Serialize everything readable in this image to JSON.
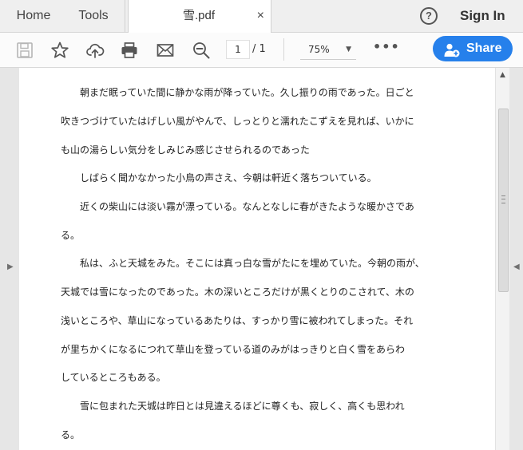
{
  "tabs": {
    "home": "Home",
    "tools": "Tools",
    "document": "雪.pdf",
    "close": "×"
  },
  "header": {
    "help": "?",
    "sign_in": "Sign In"
  },
  "toolbar": {
    "page_current": "1",
    "page_total": "/ 1",
    "zoom": "75%",
    "zoom_caret": "▼",
    "more": "•••",
    "share": "Share"
  },
  "icons": [
    "save-icon",
    "star-icon",
    "upload-cloud-icon",
    "print-icon",
    "mail-icon",
    "zoom-out-icon",
    "add-user-icon"
  ],
  "colors": {
    "accent": "#2680eb"
  },
  "document": {
    "lines": [
      "　　朝まだ眠っていた間に静かな雨が降っていた。久し振りの雨であった。日ごと",
      "吹きつづけていたはげしい風がやんで、しっとりと濡れたこずえを見れば、いかに",
      "も山の湯らしい気分をしみじみ感じさせられるのであった",
      "　　しばらく聞かなかった小鳥の声さえ、今朝は軒近く落ちついている。",
      "　　近くの柴山には淡い霧が漂っている。なんとなしに春がきたような暖かさであ",
      "る。",
      "　　私は、ふと天城をみた。そこには真っ白な雪がたにを埋めていた。今朝の雨が、",
      "天城では雪になったのであった。木の深いところだけが黒くとりのこされて、木の",
      "浅いところや、草山になっているあたりは、すっかり雪に被われてしまった。それ",
      "が里ちかくになるにつれて草山を登っている道のみがはっきりと白く雪をあらわ",
      "しているところもある。",
      "　　雪に包まれた天城は昨日とは見違えるほどに尊くも、寂しく、高くも思われ",
      "る。"
    ]
  }
}
